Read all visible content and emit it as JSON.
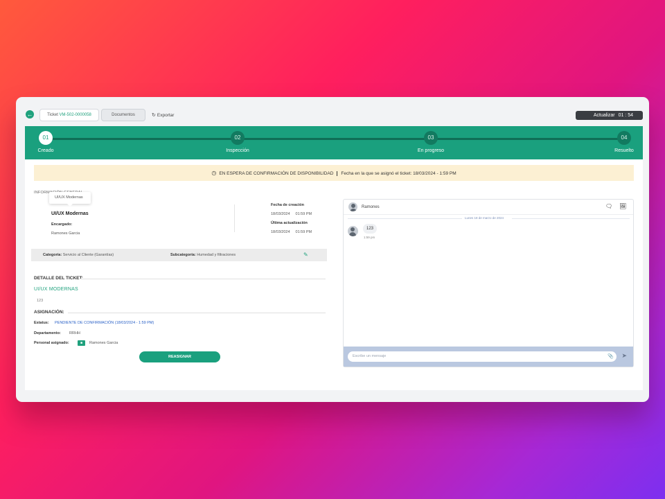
{
  "toolbar": {
    "ticket_label": "Ticket ",
    "ticket_id": "VM-502-0000058",
    "docs_label": "Documentos",
    "export_label": "Exportar",
    "refresh_label": "Actualizar",
    "countdown": "01 : 54"
  },
  "steps": [
    {
      "num": "01",
      "label": "Creado",
      "active": true
    },
    {
      "num": "02",
      "label": "Inspección",
      "active": false
    },
    {
      "num": "03",
      "label": "En progreso",
      "active": false
    },
    {
      "num": "04",
      "label": "Resuelto",
      "active": false
    }
  ],
  "banner": {
    "status": "EN ESPERA DE CONFIRMACIÓN DE DISPONIBILIDAD",
    "assigned": "Fecha en la que se asignó el ticket: 18/03/2024 - 1:59 PM"
  },
  "info": {
    "header": "INFORMACIÓN GENERAL",
    "tooltip": "UI/UX Modernas",
    "ticket_name": "UI/UX Modernas",
    "assignee_label": "Encargado:",
    "assignee": "Ramones Garcia",
    "created_label": "Fecha de creación",
    "created_date": "18/03/2024",
    "created_time": "01:59 PM",
    "updated_label": "Última actualización",
    "updated_date": "18/03/2024",
    "updated_time": "01:59 PM"
  },
  "category": {
    "cat_label": "Categoría:",
    "cat_value": "Servicio al Cliente (Garantías)",
    "sub_label": "Subcategoría:",
    "sub_value": "Humedad y filtraciones"
  },
  "detail": {
    "section_title": "DETALLE DEL TICKET:",
    "title": "UI/UX MODERNAS",
    "description": "123"
  },
  "assignment": {
    "section_title": "ASIGNACIÓN:",
    "status_label": "Estatus:",
    "status_value": "PENDIENTE DE CONFIRMACIÓN (18/03/2024 - 1:59 PM)",
    "dept_label": "Departamento:",
    "dept_value": "RRHH",
    "staff_label": "Personal asignado:",
    "staff_value": "Ramones Garcia",
    "reassign_label": "REASIGNAR"
  },
  "chat": {
    "contact": "Ramones",
    "date_divider": "Lunes 18 de marzo de 2024",
    "message": "123",
    "message_time": "1:59 pm",
    "input_placeholder": "Escribe un mensaje"
  },
  "colors": {
    "accent": "#1aa07e",
    "banner_bg": "#fcf0d3",
    "link": "#2b62c7",
    "refresh_bg": "#3a3d42"
  }
}
